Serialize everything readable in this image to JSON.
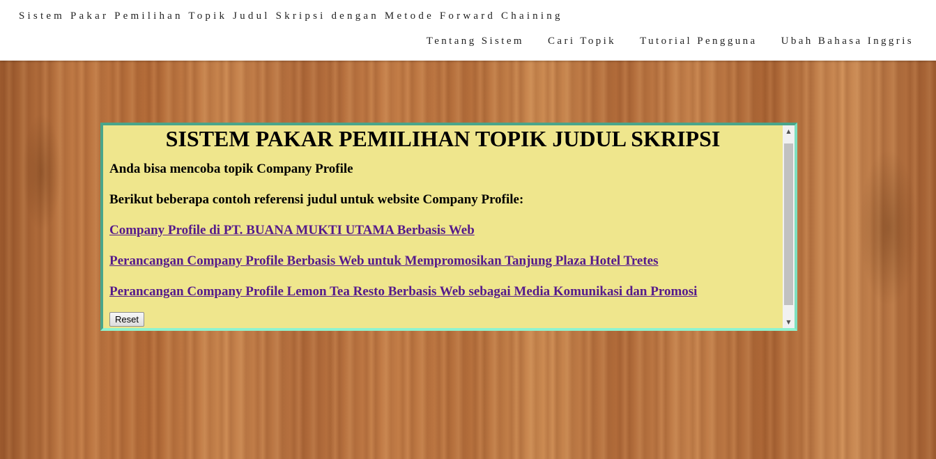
{
  "header": {
    "site_title": "Sistem Pakar Pemilihan Topik Judul Skripsi dengan Metode Forward Chaining",
    "nav": [
      {
        "label": "Tentang Sistem"
      },
      {
        "label": "Cari Topik"
      },
      {
        "label": "Tutorial Pengguna"
      },
      {
        "label": "Ubah Bahasa Inggris"
      }
    ]
  },
  "panel": {
    "heading": "SISTEM PAKAR PEMILIHAN TOPIK JUDUL SKRIPSI",
    "suggestion": "Anda bisa mencoba topik Company Profile",
    "references_intro": "Berikut beberapa contoh referensi judul untuk website Company Profile:",
    "links": [
      {
        "text": "Company Profile di PT. BUANA MUKTI UTAMA Berbasis Web"
      },
      {
        "text": "Perancangan Company Profile Berbasis Web untuk Mempromosikan Tanjung Plaza Hotel Tretes"
      },
      {
        "text": "Perancangan Company Profile Lemon Tea Resto Berbasis Web sebagai Media Komunikasi dan Promosi"
      }
    ],
    "reset_label": "Reset",
    "scroll_up_icon": "▲",
    "scroll_down_icon": "▼"
  },
  "colors": {
    "panel_background": "#efe68d",
    "panel_border": "#4aa58a",
    "link": "#551a8b"
  }
}
